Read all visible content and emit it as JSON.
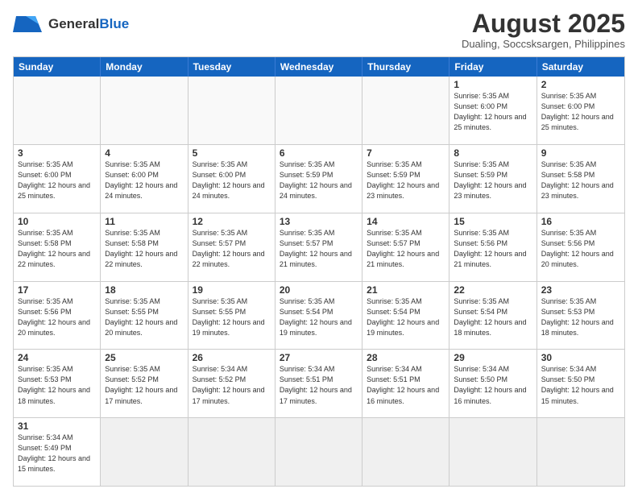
{
  "header": {
    "logo_general": "General",
    "logo_blue": "Blue",
    "month_year": "August 2025",
    "location": "Dualing, Soccsksargen, Philippines"
  },
  "weekdays": [
    "Sunday",
    "Monday",
    "Tuesday",
    "Wednesday",
    "Thursday",
    "Friday",
    "Saturday"
  ],
  "rows": [
    [
      {
        "day": "",
        "info": ""
      },
      {
        "day": "",
        "info": ""
      },
      {
        "day": "",
        "info": ""
      },
      {
        "day": "",
        "info": ""
      },
      {
        "day": "",
        "info": ""
      },
      {
        "day": "1",
        "info": "Sunrise: 5:35 AM\nSunset: 6:00 PM\nDaylight: 12 hours\nand 25 minutes."
      },
      {
        "day": "2",
        "info": "Sunrise: 5:35 AM\nSunset: 6:00 PM\nDaylight: 12 hours\nand 25 minutes."
      }
    ],
    [
      {
        "day": "3",
        "info": "Sunrise: 5:35 AM\nSunset: 6:00 PM\nDaylight: 12 hours\nand 25 minutes."
      },
      {
        "day": "4",
        "info": "Sunrise: 5:35 AM\nSunset: 6:00 PM\nDaylight: 12 hours\nand 24 minutes."
      },
      {
        "day": "5",
        "info": "Sunrise: 5:35 AM\nSunset: 6:00 PM\nDaylight: 12 hours\nand 24 minutes."
      },
      {
        "day": "6",
        "info": "Sunrise: 5:35 AM\nSunset: 5:59 PM\nDaylight: 12 hours\nand 24 minutes."
      },
      {
        "day": "7",
        "info": "Sunrise: 5:35 AM\nSunset: 5:59 PM\nDaylight: 12 hours\nand 23 minutes."
      },
      {
        "day": "8",
        "info": "Sunrise: 5:35 AM\nSunset: 5:59 PM\nDaylight: 12 hours\nand 23 minutes."
      },
      {
        "day": "9",
        "info": "Sunrise: 5:35 AM\nSunset: 5:58 PM\nDaylight: 12 hours\nand 23 minutes."
      }
    ],
    [
      {
        "day": "10",
        "info": "Sunrise: 5:35 AM\nSunset: 5:58 PM\nDaylight: 12 hours\nand 22 minutes."
      },
      {
        "day": "11",
        "info": "Sunrise: 5:35 AM\nSunset: 5:58 PM\nDaylight: 12 hours\nand 22 minutes."
      },
      {
        "day": "12",
        "info": "Sunrise: 5:35 AM\nSunset: 5:57 PM\nDaylight: 12 hours\nand 22 minutes."
      },
      {
        "day": "13",
        "info": "Sunrise: 5:35 AM\nSunset: 5:57 PM\nDaylight: 12 hours\nand 21 minutes."
      },
      {
        "day": "14",
        "info": "Sunrise: 5:35 AM\nSunset: 5:57 PM\nDaylight: 12 hours\nand 21 minutes."
      },
      {
        "day": "15",
        "info": "Sunrise: 5:35 AM\nSunset: 5:56 PM\nDaylight: 12 hours\nand 21 minutes."
      },
      {
        "day": "16",
        "info": "Sunrise: 5:35 AM\nSunset: 5:56 PM\nDaylight: 12 hours\nand 20 minutes."
      }
    ],
    [
      {
        "day": "17",
        "info": "Sunrise: 5:35 AM\nSunset: 5:56 PM\nDaylight: 12 hours\nand 20 minutes."
      },
      {
        "day": "18",
        "info": "Sunrise: 5:35 AM\nSunset: 5:55 PM\nDaylight: 12 hours\nand 20 minutes."
      },
      {
        "day": "19",
        "info": "Sunrise: 5:35 AM\nSunset: 5:55 PM\nDaylight: 12 hours\nand 19 minutes."
      },
      {
        "day": "20",
        "info": "Sunrise: 5:35 AM\nSunset: 5:54 PM\nDaylight: 12 hours\nand 19 minutes."
      },
      {
        "day": "21",
        "info": "Sunrise: 5:35 AM\nSunset: 5:54 PM\nDaylight: 12 hours\nand 19 minutes."
      },
      {
        "day": "22",
        "info": "Sunrise: 5:35 AM\nSunset: 5:54 PM\nDaylight: 12 hours\nand 18 minutes."
      },
      {
        "day": "23",
        "info": "Sunrise: 5:35 AM\nSunset: 5:53 PM\nDaylight: 12 hours\nand 18 minutes."
      }
    ],
    [
      {
        "day": "24",
        "info": "Sunrise: 5:35 AM\nSunset: 5:53 PM\nDaylight: 12 hours\nand 18 minutes."
      },
      {
        "day": "25",
        "info": "Sunrise: 5:35 AM\nSunset: 5:52 PM\nDaylight: 12 hours\nand 17 minutes."
      },
      {
        "day": "26",
        "info": "Sunrise: 5:34 AM\nSunset: 5:52 PM\nDaylight: 12 hours\nand 17 minutes."
      },
      {
        "day": "27",
        "info": "Sunrise: 5:34 AM\nSunset: 5:51 PM\nDaylight: 12 hours\nand 17 minutes."
      },
      {
        "day": "28",
        "info": "Sunrise: 5:34 AM\nSunset: 5:51 PM\nDaylight: 12 hours\nand 16 minutes."
      },
      {
        "day": "29",
        "info": "Sunrise: 5:34 AM\nSunset: 5:50 PM\nDaylight: 12 hours\nand 16 minutes."
      },
      {
        "day": "30",
        "info": "Sunrise: 5:34 AM\nSunset: 5:50 PM\nDaylight: 12 hours\nand 15 minutes."
      }
    ],
    [
      {
        "day": "31",
        "info": "Sunrise: 5:34 AM\nSunset: 5:49 PM\nDaylight: 12 hours\nand 15 minutes."
      },
      {
        "day": "",
        "info": ""
      },
      {
        "day": "",
        "info": ""
      },
      {
        "day": "",
        "info": ""
      },
      {
        "day": "",
        "info": ""
      },
      {
        "day": "",
        "info": ""
      },
      {
        "day": "",
        "info": ""
      }
    ]
  ]
}
